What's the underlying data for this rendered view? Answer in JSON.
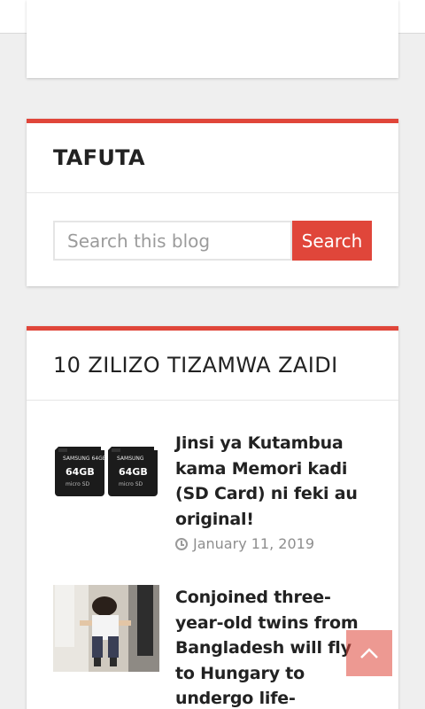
{
  "search_widget": {
    "title": "TAFUTA",
    "placeholder": "Search this blog",
    "button_label": "Search"
  },
  "popular_widget": {
    "title": "10 ZILIZO TIZAMWA ZAIDI",
    "posts": [
      {
        "title": "Jinsi ya Kutambua kama Memori kadi (SD Card) ni feki au original!",
        "date": "January 11, 2019",
        "thumb_text": "SAMSUNG 64GB"
      },
      {
        "title": "Conjoined three-year-old twins from Bangladesh will fly to Hungary to undergo life-changing surgery",
        "date": ""
      }
    ]
  },
  "colors": {
    "accent": "#e0463a"
  },
  "icons": {
    "date": "clock-icon",
    "back_to_top": "chevron-up-icon"
  }
}
